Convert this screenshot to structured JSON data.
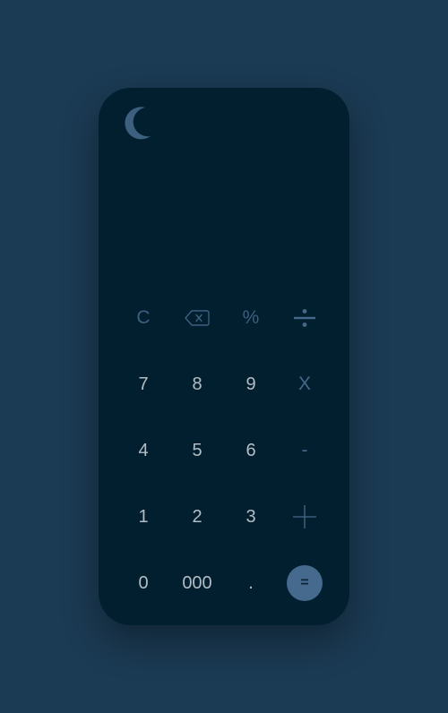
{
  "theme_toggle": {
    "icon": "moon-icon",
    "color": "#3d5f80"
  },
  "display": {
    "value": ""
  },
  "keys": {
    "clear": "C",
    "backspace_icon": "backspace-icon",
    "percent": "%",
    "divide_icon": "divide-icon",
    "seven": "7",
    "eight": "8",
    "nine": "9",
    "multiply": "X",
    "four": "4",
    "five": "5",
    "six": "6",
    "subtract": "-",
    "one": "1",
    "two": "2",
    "three": "3",
    "add_icon": "plus-icon",
    "zero": "0",
    "triple_zero": "000",
    "decimal": ".",
    "equals": "="
  },
  "colors": {
    "page_background": "#1b3a53",
    "calculator_background": "#011f2e",
    "digit_text": "#b3bdc6",
    "function_text": "#3d5f80",
    "operator_text": "#46698b",
    "equals_background": "#456a8d"
  }
}
